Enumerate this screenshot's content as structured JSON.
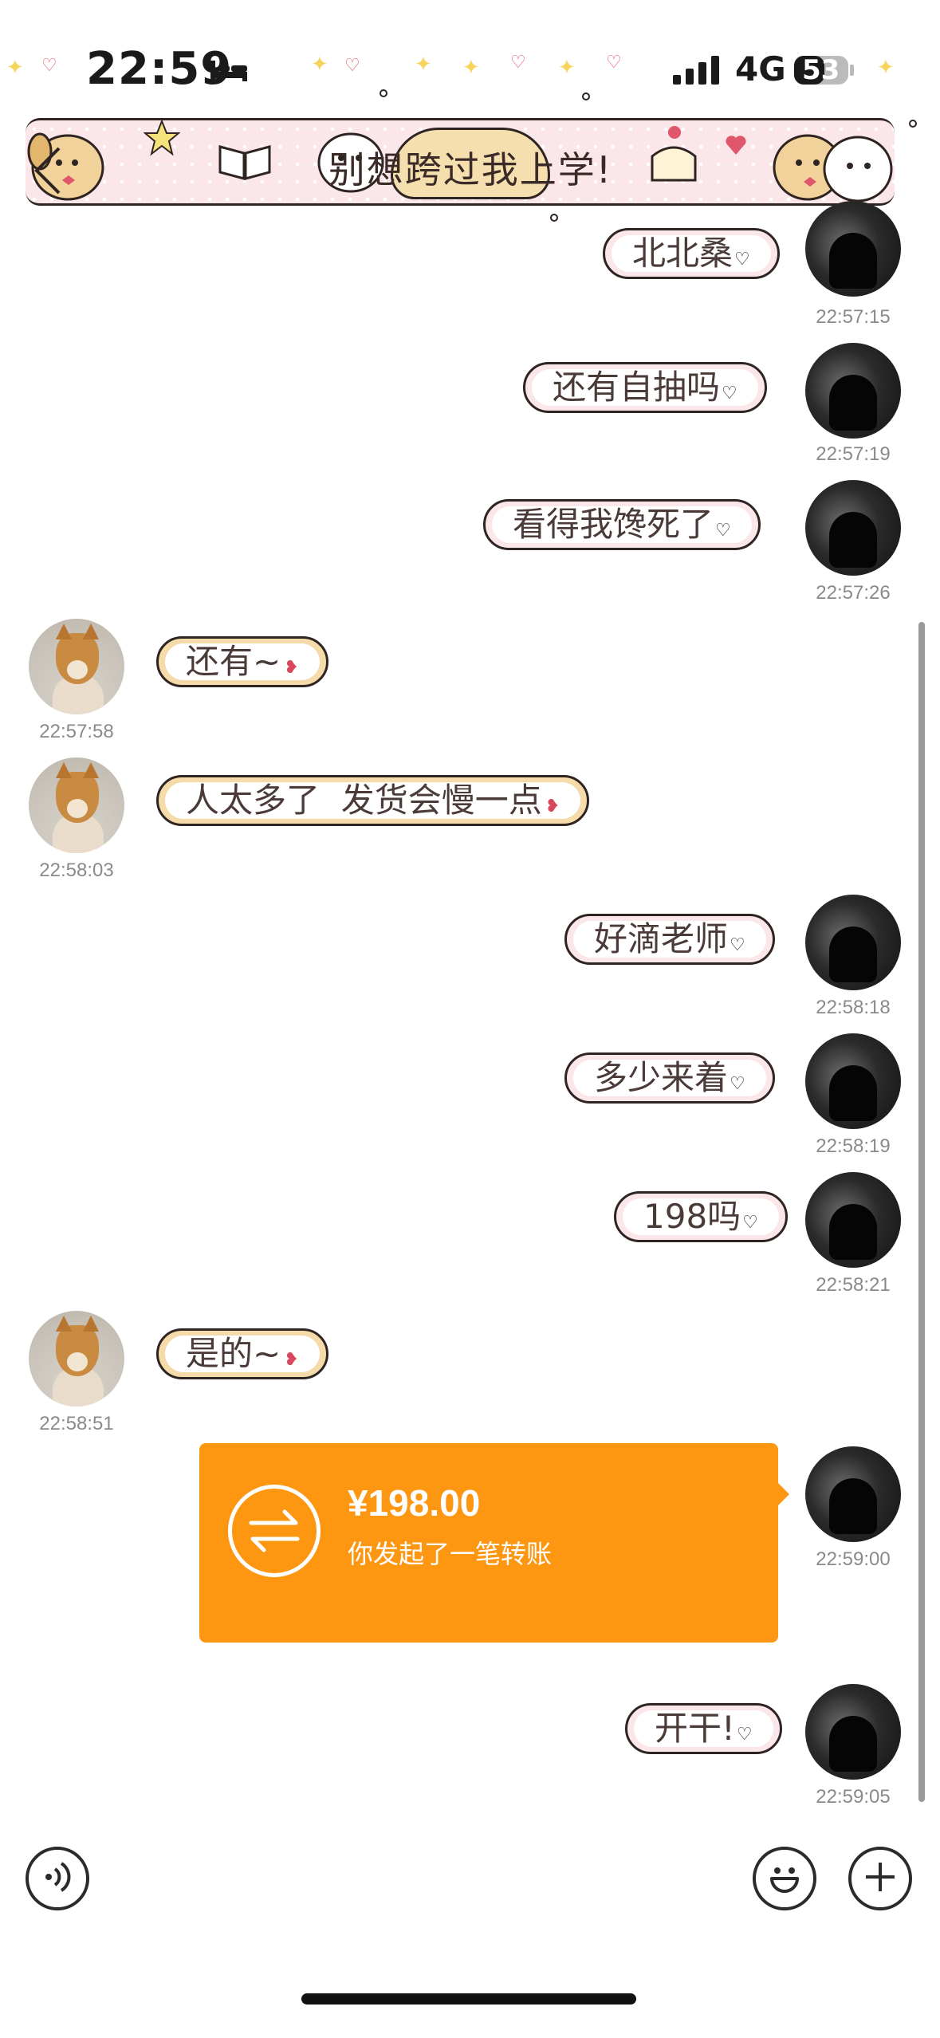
{
  "status_bar": {
    "time": "22:59",
    "network": "4G",
    "battery": "53"
  },
  "header": {
    "title": "别想跨过我上学!"
  },
  "messages": [
    {
      "side": "right",
      "text": "北北桑",
      "time": "22:57:15"
    },
    {
      "side": "right",
      "text": "还有自抽吗",
      "time": "22:57:19"
    },
    {
      "side": "right",
      "text": "看得我馋死了",
      "time": "22:57:26"
    },
    {
      "side": "left",
      "text": "还有~",
      "time": "22:57:58"
    },
    {
      "side": "left",
      "text": "人太多了  发货会慢一点",
      "time": "22:58:03"
    },
    {
      "side": "right",
      "text": "好滴老师",
      "time": "22:58:18"
    },
    {
      "side": "right",
      "text": "多少来着",
      "time": "22:58:19"
    },
    {
      "side": "right",
      "text": "198吗",
      "time": "22:58:21"
    },
    {
      "side": "left",
      "text": "是的~",
      "time": "22:58:51"
    },
    {
      "side": "right",
      "text": "",
      "time": "22:59:00"
    },
    {
      "side": "right",
      "text": "开干!",
      "time": "22:59:05"
    }
  ],
  "transfer": {
    "amount": "¥198.00",
    "description": "你发起了一笔转账"
  },
  "icons": {
    "back": "chevron-left-icon",
    "voice": "voice-icon",
    "emoji": "emoji-icon",
    "add": "plus-icon",
    "transfer": "transfer-arrows-icon"
  },
  "colors": {
    "transfer_card": "#fd9712",
    "outgoing_bubble_frame": "#fbe6ea",
    "incoming_bubble_frame": "#f5dba9"
  }
}
